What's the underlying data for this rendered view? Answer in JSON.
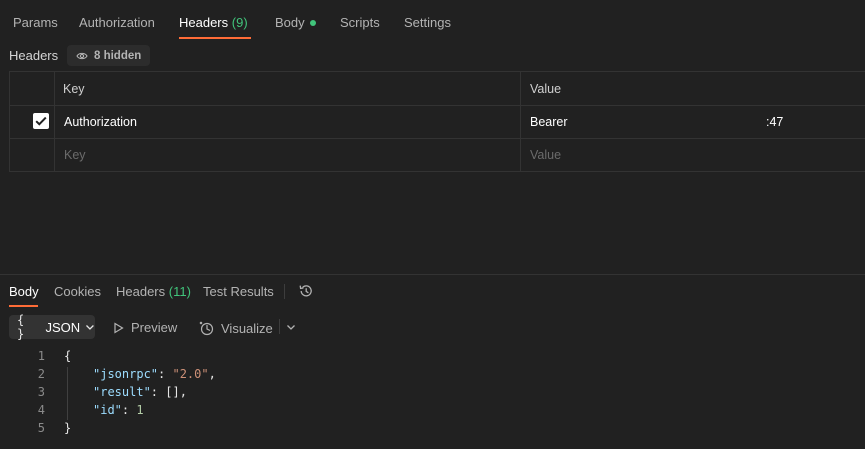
{
  "request_tabs": {
    "params": "Params",
    "authorization": "Authorization",
    "headers": "Headers",
    "headers_count": "(9)",
    "body": "Body",
    "scripts": "Scripts",
    "settings": "Settings"
  },
  "headers_section": {
    "title": "Headers",
    "hidden_label": "8 hidden",
    "col_key": "Key",
    "col_value": "Value",
    "rows": [
      {
        "checked": true,
        "key": "Authorization",
        "value_prefix": "Bearer",
        "value_suffix": ":47"
      }
    ],
    "key_placeholder": "Key",
    "value_placeholder": "Value"
  },
  "response_tabs": {
    "body": "Body",
    "cookies": "Cookies",
    "headers": "Headers",
    "headers_count": "(11)",
    "test_results": "Test Results"
  },
  "response_toolbar": {
    "format": "JSON",
    "braces": "{ }",
    "preview": "Preview",
    "visualize": "Visualize"
  },
  "response_body": {
    "line_numbers": [
      "1",
      "2",
      "3",
      "4",
      "5"
    ],
    "brace_open": "{",
    "brace_close": "}",
    "lines": [
      {
        "key": "\"jsonrpc\"",
        "sep": ": ",
        "value": "\"2.0\"",
        "trail": ","
      },
      {
        "key": "\"result\"",
        "sep": ": ",
        "value": "[]",
        "trail": ","
      },
      {
        "key": "\"id\"",
        "sep": ": ",
        "value": "1",
        "trail": ""
      }
    ]
  },
  "colors": {
    "accent": "#ff6c37",
    "success": "#41c47b",
    "background": "#212121"
  }
}
